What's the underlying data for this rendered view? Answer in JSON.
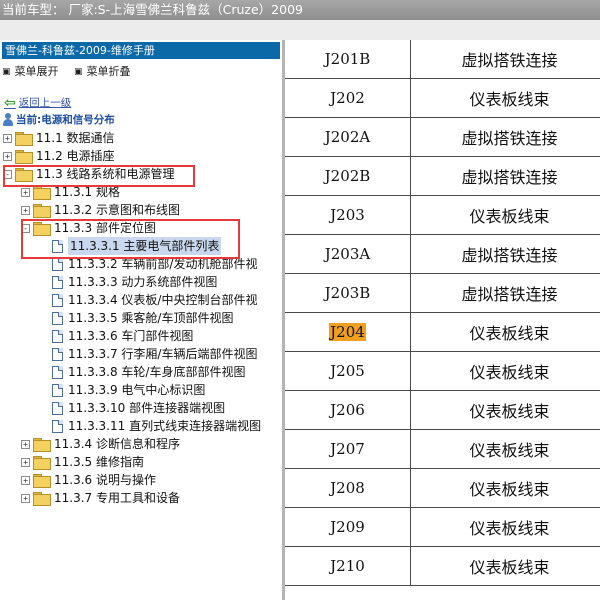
{
  "header": {
    "text": "当前车型：  厂家:S-上海雪佛兰科鲁兹（Cruze）2009"
  },
  "sidebar": {
    "title": "雪佛兰-科鲁兹-2009-维修手册",
    "menu": {
      "expand": "菜单展开",
      "collapse": "菜单折叠"
    },
    "back_link": "返回上一级",
    "current_location": "当前:电源和信号分布",
    "tree": [
      {
        "label": "11.1 数据通信",
        "level": 0,
        "type": "folder",
        "toggle": "+"
      },
      {
        "label": "11.2 电源插座",
        "level": 0,
        "type": "folder",
        "toggle": "+"
      },
      {
        "label": "11.3 线路系统和电源管理",
        "level": 0,
        "type": "folder",
        "toggle": "-"
      },
      {
        "label": "11.3.1 规格",
        "level": 1,
        "type": "folder",
        "toggle": "+"
      },
      {
        "label": "11.3.2 示意图和布线图",
        "level": 1,
        "type": "folder",
        "toggle": "+"
      },
      {
        "label": "11.3.3 部件定位图",
        "level": 1,
        "type": "folder",
        "toggle": "-"
      },
      {
        "label": "11.3.3.1 主要电气部件列表",
        "level": 2,
        "type": "doc",
        "selected": true
      },
      {
        "label": "11.3.3.2 车辆前部/发动机舱部件视",
        "level": 2,
        "type": "doc"
      },
      {
        "label": "11.3.3.3 动力系统部件视图",
        "level": 2,
        "type": "doc"
      },
      {
        "label": "11.3.3.4 仪表板/中央控制台部件视",
        "level": 2,
        "type": "doc"
      },
      {
        "label": "11.3.3.5 乘客舱/车顶部件视图",
        "level": 2,
        "type": "doc"
      },
      {
        "label": "11.3.3.6 车门部件视图",
        "level": 2,
        "type": "doc"
      },
      {
        "label": "11.3.3.7 行李厢/车辆后端部件视图",
        "level": 2,
        "type": "doc"
      },
      {
        "label": "11.3.3.8 车轮/车身底部部件视图",
        "level": 2,
        "type": "doc"
      },
      {
        "label": "11.3.3.9 电气中心标识图",
        "level": 2,
        "type": "doc"
      },
      {
        "label": "11.3.3.10 部件连接器端视图",
        "level": 2,
        "type": "doc"
      },
      {
        "label": "11.3.3.11 直列式线束连接器端视图",
        "level": 2,
        "type": "doc"
      },
      {
        "label": "11.3.4 诊断信息和程序",
        "level": 1,
        "type": "folder",
        "toggle": "+"
      },
      {
        "label": "11.3.5 维修指南",
        "level": 1,
        "type": "folder",
        "toggle": "+"
      },
      {
        "label": "11.3.6 说明与操作",
        "level": 1,
        "type": "folder",
        "toggle": "+"
      },
      {
        "label": "11.3.7 专用工具和设备",
        "level": 1,
        "type": "folder",
        "toggle": "+"
      }
    ]
  },
  "table": {
    "rows": [
      {
        "code": "J201B",
        "desc": "虚拟搭铁连接"
      },
      {
        "code": "J202",
        "desc": "仪表板线束"
      },
      {
        "code": "J202A",
        "desc": "虚拟搭铁连接"
      },
      {
        "code": "J202B",
        "desc": "虚拟搭铁连接"
      },
      {
        "code": "J203",
        "desc": "仪表板线束"
      },
      {
        "code": "J203A",
        "desc": "虚拟搭铁连接"
      },
      {
        "code": "J203B",
        "desc": "虚拟搭铁连接"
      },
      {
        "code": "J204",
        "desc": "仪表板线束",
        "highlight": true
      },
      {
        "code": "J205",
        "desc": "仪表板线束"
      },
      {
        "code": "J206",
        "desc": "仪表板线束"
      },
      {
        "code": "J207",
        "desc": "仪表板线束"
      },
      {
        "code": "J208",
        "desc": "仪表板线束"
      },
      {
        "code": "J209",
        "desc": "仪表板线束"
      },
      {
        "code": "J210",
        "desc": "仪表板线束"
      }
    ]
  },
  "colors": {
    "header_bg": "#999999",
    "sidebar_title_bg": "#0b69a8",
    "highlight": "#f0a020",
    "annotation_red": "#e63a3a",
    "selected_bg": "#c9d8ee"
  }
}
